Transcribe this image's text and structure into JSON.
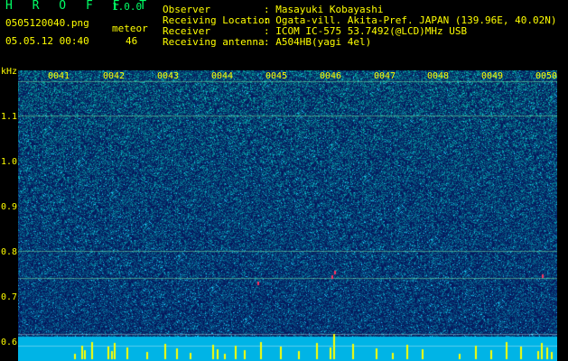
{
  "header": {
    "title": "H R O F F T",
    "version": "1.0.0",
    "filename": "0505120040.png",
    "datetime": "05.05.12 00:40",
    "meteor_label": "meteor",
    "meteor_count": "46"
  },
  "info": [
    {
      "label": "Observer",
      "value": ": Masayuki Kobayashi"
    },
    {
      "label": "Receiving Location",
      "value": ": Ogata-vill. Akita-Pref. JAPAN (139.96E, 40.02N)"
    },
    {
      "label": "Receiver",
      "value": ": ICOM IC-575 53.7492(@LCD)MHz USB"
    },
    {
      "label": "Receiving antenna",
      "value": ": A504HB(yagi 4el)"
    }
  ],
  "axis": {
    "unit": "kHz",
    "ticks": [
      "1.1",
      "1.0",
      "0.9",
      "0.8",
      "0.7",
      "0.6"
    ],
    "time_labels": [
      "0041",
      "0042",
      "0043",
      "0044",
      "0045",
      "0046",
      "0047",
      "0048",
      "0049",
      "0050"
    ]
  },
  "colors": {
    "text": "#ffff00",
    "title": "#00ff66",
    "background": "#000000",
    "spectrum_low": "#0a1e8c",
    "spectrum_high": "#00e0ff",
    "meteor_bar": "#ffff00"
  }
}
